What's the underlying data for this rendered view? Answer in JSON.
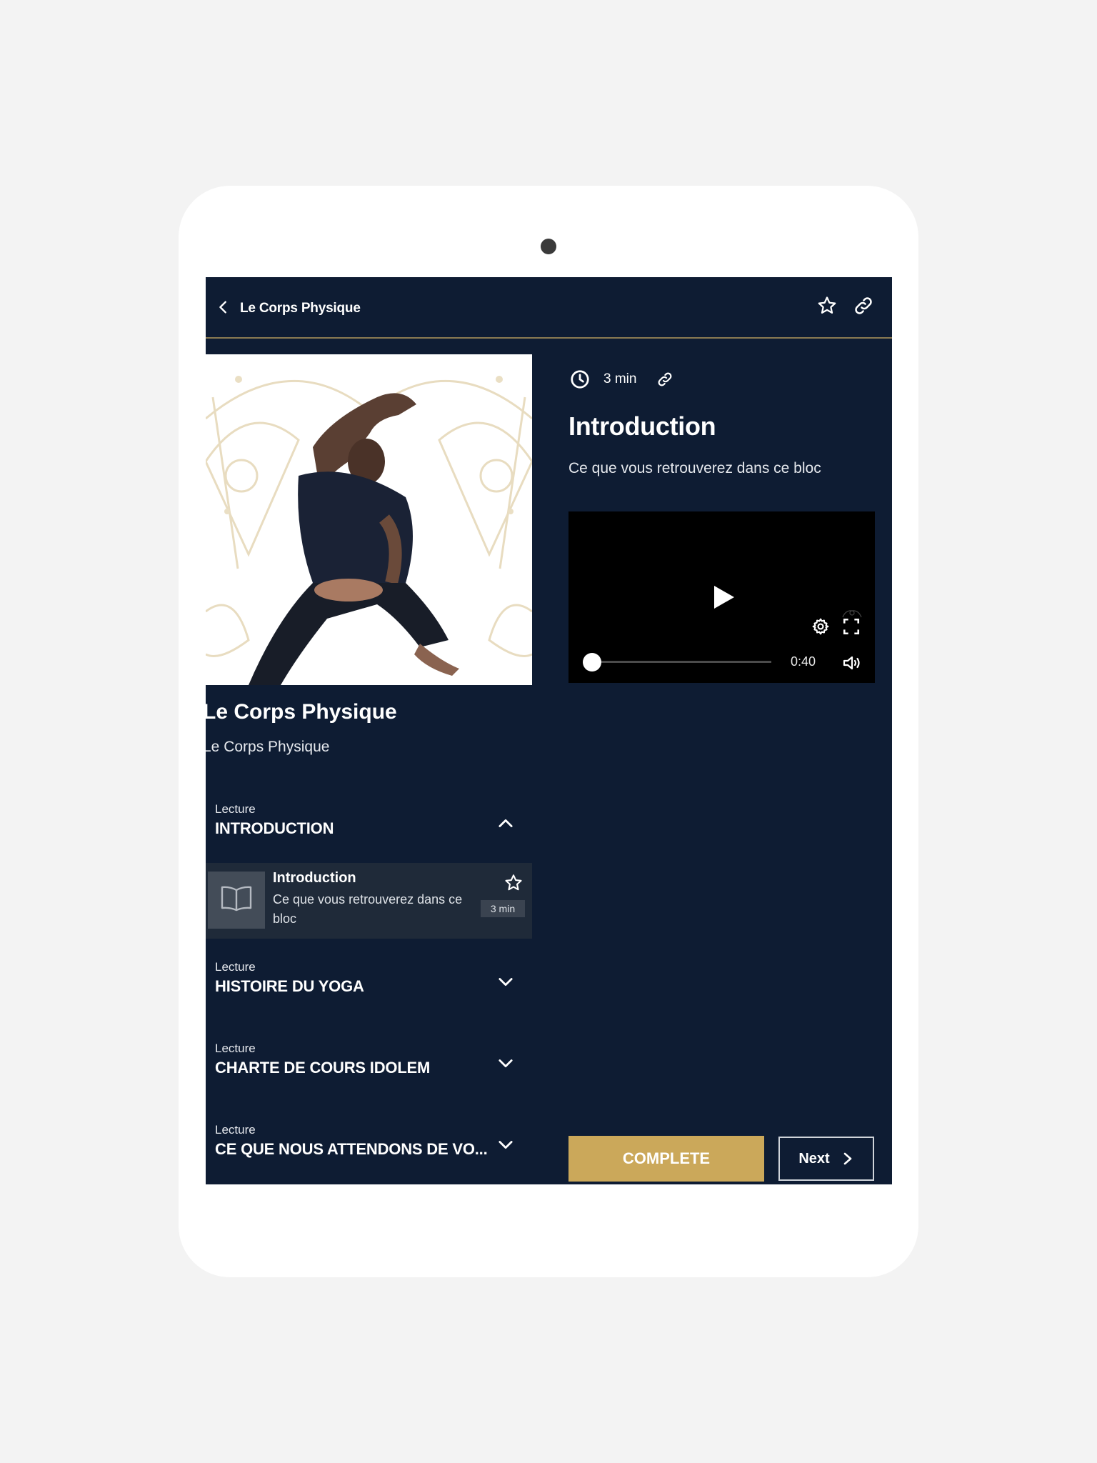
{
  "header": {
    "back_label": "Le Corps Physique",
    "icons": [
      "chevron-left-icon",
      "star-icon",
      "link-icon"
    ]
  },
  "course": {
    "title": "Le Corps Physique",
    "subtitle": "Le Corps Physique",
    "cover_image": "yoga-pose-photo-on-mandala-background"
  },
  "sections": [
    {
      "kind": "Lecture",
      "name": "INTRODUCTION",
      "expanded": true
    },
    {
      "kind": "Lecture",
      "name": "HISTOIRE DU YOGA",
      "expanded": false
    },
    {
      "kind": "Lecture",
      "name": "CHARTE DE COURS IDOLEM",
      "expanded": false
    },
    {
      "kind": "Lecture",
      "name": "CE QUE NOUS ATTENDONS DE VO...",
      "expanded": false
    }
  ],
  "lesson_item": {
    "title": "Introduction",
    "description": "Ce que vous retrouverez dans ce bloc",
    "duration": "3 min",
    "icon": "book-icon"
  },
  "content": {
    "duration": "3 min",
    "title": "Introduction",
    "subtitle": "Ce que vous retrouverez dans ce bloc"
  },
  "player": {
    "time_remaining": "0:40",
    "progress": 0
  },
  "actions": {
    "complete_label": "COMPLETE",
    "next_label": "Next"
  },
  "colors": {
    "background": "#0e1c33",
    "accent_gold": "#cba85a",
    "lesson_row": "#1f2a39"
  }
}
